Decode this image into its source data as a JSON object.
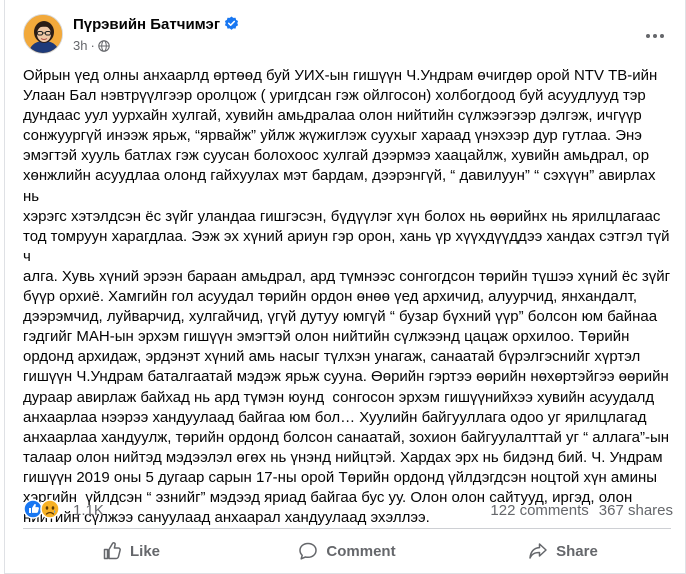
{
  "post": {
    "author_name": "Пүрэвийн Батчимэг",
    "time": "3h",
    "separator": "·",
    "body": "Ойрын үед олны анхаарлд өртөөд буй УИХ-ын гишүүн Ч.Ундрам өчигдөр орой NTV ТВ-ийн\nУлаан Бал нэвтрүүлгээр оролцож ( уригдсан гэж ойлгосон) холбогдоод буй асуудлууд тэр\nдундаас уул уурхайн хулгай, хувийн амьдралаа олон нийтийн сүлжээгээр дэлгэж, ичгүүр\nсонжуургүй инээж ярьж, “ярвайж” уйлж жүжиглэж суухыг хараад үнэхээр дур гутлаа. Энэ\nэмэгтэй хууль батлах гэж суусан болохоос хулгай дээрмээ хаацайлж, хувийн амьдрал, ор\nхөнжлийн асуудлаа олонд гайхуулах мэт бардам, дээрэнгүй, “ давилуун” “ сэхүүн” авирлах нь\nхэрэгс хэтэлдсэн ёс зүйг уландаа гишгэсэн, бүдүүлэг хүн болох нь өөрийнх нь ярилцлагаас\nтод томруун харагдлаа. Ээж эх хүний ариун гэр орон, хань үр хүүхдүүддээ хандах сэтгэл түй ч\nалга. Хувь хүний эрээн бараан амьдрал, ард түмнээс сонгогдсон төрийн түшээ хүний ёс зүйг\nбүүр орхиё. Хамгийн гол асуудал төрийн ордон өнөө үед архичид, алуурчид, янхандалт,\nдээрэмчид, луйварчид, хулгайчид, үгүй дутуу юмгүй “ бузар бүхний үүр” болсон юм байнаа\nгэдгийг МАН-ын эрхэм гишүүн эмэгтэй олон нийтийн сүлжээнд цацаж орхилоо. Төрийн\nордонд архидаж, эрдэнэт хүний амь насыг түлхэн унагаж, санаатай бүрэлгэснийг хүртэл\nгишүүн Ч.Ундрам баталгаатай мэдэж ярьж сууна. Өөрийн гэртээ өөрийн нөхөртэйгээ өөрийн\nдураар авирлаж байхад нь ард түмэн юунд  сонгосон эрхэм гишүүнийхээ хувийн асуудалд\nанхаарлаа нээрээ хандуулаад байгаа юм бол… Хуулийн байгууллага одоо уг ярилцлагад\nанхаарлаа хандуулж, төрийн ордонд болсон санаатай, зохион байгуулалттай уг “ аллага”-ын\nталаар олон нийтэд мэдээлэл өгөх нь үнэнд нийцтэй. Хардах эрх нь бидэнд бий. Ч. Ундрам\nгишүүн 2019 оны 5 дугаар сарын 17-ны орой Төрийн ордонд үйлдэгдсэн ноцтой хүн амины\nхэргийн  үйлдсэн “ эзнийг” мэдээд яриад байгаа бус уу. Олон олон сайтууд, иргэд, олон\nнийтийн сүлжээ сануулаад анхаарал хандуулаад эхэллээ."
  },
  "engagement": {
    "reaction_count": "1.1K",
    "comments": "122 comments",
    "shares": "367 shares"
  },
  "actions": {
    "like": "Like",
    "comment": "Comment",
    "share": "Share"
  },
  "icons": {
    "verified": "verified-badge-icon",
    "globe": "globe-icon",
    "more": "more-horizontal-icon",
    "like_reaction": "like-reaction-icon",
    "sad_reaction": "sad-reaction-icon",
    "like": "thumbs-up-icon",
    "comment": "comment-bubble-icon",
    "share": "share-arrow-icon"
  },
  "colors": {
    "accent": "#1877f2",
    "secondary_text": "#65676b",
    "sad_yellow": "#f7b125"
  }
}
